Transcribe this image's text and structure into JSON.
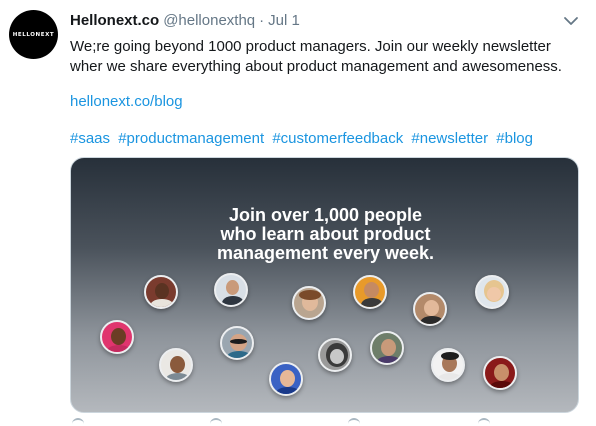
{
  "tweet": {
    "avatar_text": "HELLONEXT",
    "display_name": "Hellonext.co",
    "handle": "@hellonexthq",
    "separator": "·",
    "date": "Jul 1",
    "body": "We;re going beyond 1000 product managers. Join our weekly newsletter wher we share everything about product management and awesomeness.",
    "link": "hellonext.co/blog",
    "hashtags": [
      "#saas",
      "#productmanagement",
      "#customerfeedback",
      "#newsletter",
      "#blog"
    ]
  },
  "card": {
    "headline_lines": [
      "Join over 1,000 people",
      "who learn about product",
      "management every week."
    ]
  },
  "icons": {
    "menu": "chevron-down-icon",
    "actions": [
      "reply-icon",
      "retweet-icon",
      "like-icon",
      "share-icon"
    ]
  },
  "colors": {
    "link": "#1b95e0",
    "muted": "#657786",
    "text": "#14171a"
  }
}
